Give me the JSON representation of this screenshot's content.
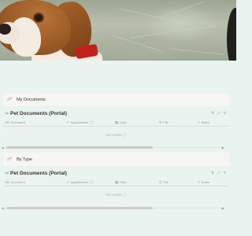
{
  "cover": {
    "alt_icon": "beagle-photo"
  },
  "sections": [
    {
      "header": "My Documents",
      "header_icon": "link-icon",
      "db_title": "Pet Documents (Portal)",
      "columns": [
        "Document",
        "Appointment",
        "Date",
        "File",
        "Notes"
      ],
      "empty_text": "No results"
    },
    {
      "header": "By Type",
      "header_icon": "link-icon",
      "db_title": "Pet Documents (Portal)",
      "columns": [
        "Document",
        "Appointment",
        "Date",
        "File",
        "Notes"
      ],
      "empty_text": "No results"
    }
  ],
  "colors": {
    "page_bg": "#e9f3ef",
    "header_bg": "#f6f5f2",
    "text": "#37352f",
    "muted": "#9b9a97"
  }
}
